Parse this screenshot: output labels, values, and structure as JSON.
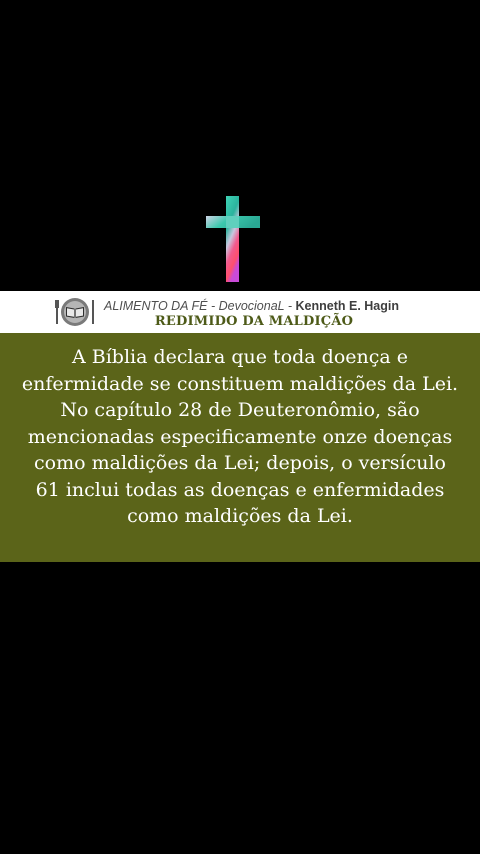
{
  "header": {
    "series_label": "ALIMENTO DA FÉ - DevocionaL -",
    "author": "Kenneth E. Hagin",
    "title": "REDIMIDO DA MALDIÇÃO"
  },
  "icons": {
    "cross": "cross-icon",
    "logo": "bible-plate-icon"
  },
  "devotional": {
    "text": "A Bíblia declara que toda doença e enfermidade se constituem maldições da Lei. No capítulo 28 de Deuteronômio, são mencionadas especificamente onze doenças como maldições da Lei; depois, o versículo 61 inclui todas as doenças e enfermidades como maldições da Lei."
  },
  "colors": {
    "background": "#000000",
    "header_background": "#ffffff",
    "panel": "#5b6419",
    "title": "#4d5a18",
    "text": "#ffffff"
  }
}
